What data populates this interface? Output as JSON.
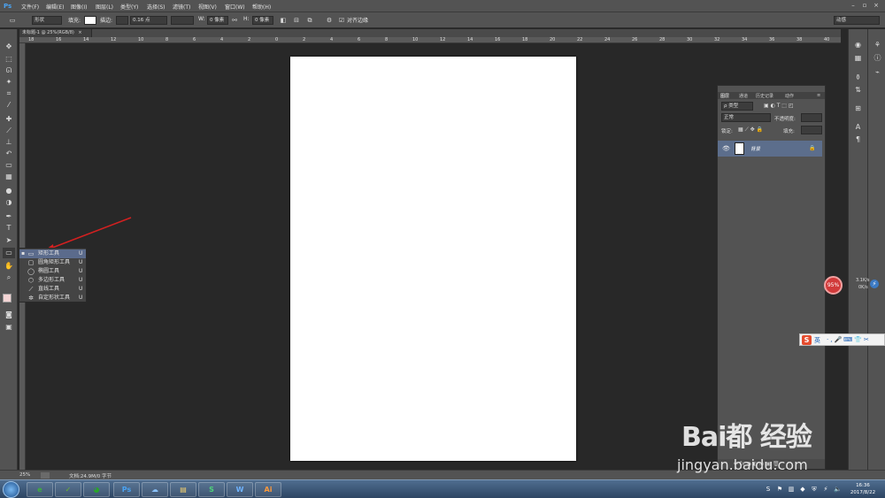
{
  "app": {
    "logo": "Ps"
  },
  "menu": [
    "文件(F)",
    "编辑(E)",
    "图像(I)",
    "图层(L)",
    "类型(Y)",
    "选择(S)",
    "滤镜(T)",
    "视图(V)",
    "窗口(W)",
    "帮助(H)"
  ],
  "options_bar": {
    "mode": "形状",
    "fill_label": "填充:",
    "stroke_label": "描边:",
    "stroke_width": "0.16 点",
    "w_label": "W:",
    "w_value": "0 像素",
    "h_label": "H:",
    "h_value": "0 像素",
    "align_edges_label": "对齐边缘",
    "workspace": "动感"
  },
  "document": {
    "tab_title": "未标题-1 @ 25%(RGB/8)",
    "ruler_marks": [
      "18",
      "16",
      "14",
      "12",
      "10",
      "8",
      "6",
      "4",
      "2",
      "0",
      "2",
      "4",
      "6",
      "8",
      "10",
      "12",
      "14",
      "16",
      "18",
      "20",
      "22",
      "24",
      "26",
      "28",
      "30",
      "32",
      "34",
      "36",
      "38",
      "40"
    ]
  },
  "toolbox": {
    "tools": [
      {
        "name": "move-tool",
        "glyph": "✥"
      },
      {
        "name": "marquee-tool",
        "glyph": "⬚"
      },
      {
        "name": "lasso-tool",
        "glyph": "ᘏ"
      },
      {
        "name": "quick-select-tool",
        "glyph": "✦"
      },
      {
        "name": "crop-tool",
        "glyph": "⌗"
      },
      {
        "name": "eyedropper-tool",
        "glyph": "⁄"
      },
      {
        "name": "healing-tool",
        "glyph": "✚"
      },
      {
        "name": "brush-tool",
        "glyph": "⟋"
      },
      {
        "name": "stamp-tool",
        "glyph": "⊥"
      },
      {
        "name": "history-brush-tool",
        "glyph": "↶"
      },
      {
        "name": "eraser-tool",
        "glyph": "▭"
      },
      {
        "name": "gradient-tool",
        "glyph": "▦"
      },
      {
        "name": "blur-tool",
        "glyph": "●"
      },
      {
        "name": "dodge-tool",
        "glyph": "◑"
      },
      {
        "name": "pen-tool",
        "glyph": "✒"
      },
      {
        "name": "type-tool",
        "glyph": "T"
      },
      {
        "name": "path-select-tool",
        "glyph": "➤"
      },
      {
        "name": "shape-tool",
        "glyph": "▭"
      },
      {
        "name": "hand-tool",
        "glyph": "✋"
      },
      {
        "name": "zoom-tool",
        "glyph": "⌕"
      }
    ]
  },
  "flyout": {
    "items": [
      {
        "label": "矩形工具",
        "key": "U",
        "glyph": "▭",
        "selected": true
      },
      {
        "label": "圆角矩形工具",
        "key": "U",
        "glyph": "▢",
        "selected": false
      },
      {
        "label": "椭圆工具",
        "key": "U",
        "glyph": "◯",
        "selected": false
      },
      {
        "label": "多边形工具",
        "key": "U",
        "glyph": "⬡",
        "selected": false
      },
      {
        "label": "直线工具",
        "key": "U",
        "glyph": "⟋",
        "selected": false
      },
      {
        "label": "自定形状工具",
        "key": "U",
        "glyph": "✲",
        "selected": false
      }
    ]
  },
  "layers_panel": {
    "tabs": [
      "图层",
      "通道",
      "历史记录",
      "动作"
    ],
    "filter_kind": "ρ 类型",
    "blend_mode": "正常",
    "opacity_label": "不透明度:",
    "lock_label": "锁定:",
    "fill_label": "填充:",
    "layer_name": "背景"
  },
  "widgets": {
    "memory_percent": "95%",
    "net_up": "3.1K/s",
    "net_down": "0K/s",
    "ime_label": "英"
  },
  "status": {
    "zoom": "25%",
    "doc_info": "文档:24.9M/0 字节"
  },
  "watermark": {
    "logo": "Bai都 经验",
    "url": "jingyan.baidu.com"
  },
  "taskbar": {
    "apps": [
      {
        "name": "360-browser",
        "label": "e",
        "color": "#3fae3f"
      },
      {
        "name": "phone-assistant",
        "label": "✓",
        "color": "#6cb62b"
      },
      {
        "name": "wechat",
        "label": "◕",
        "color": "#2aa52a"
      },
      {
        "name": "photoshop",
        "label": "Ps",
        "color": "#1b3a5c"
      },
      {
        "name": "baidu-netdisk",
        "label": "☁",
        "color": "#2d7fd6"
      },
      {
        "name": "file-explorer",
        "label": "▤",
        "color": "#d8b04a"
      },
      {
        "name": "wps-sheets",
        "label": "S",
        "color": "#1fa14a"
      },
      {
        "name": "wps-writer",
        "label": "W",
        "color": "#2c86d6"
      },
      {
        "name": "illustrator",
        "label": "Ai",
        "color": "#a8460e"
      }
    ],
    "time": "16:36",
    "date": "2017/8/22"
  }
}
